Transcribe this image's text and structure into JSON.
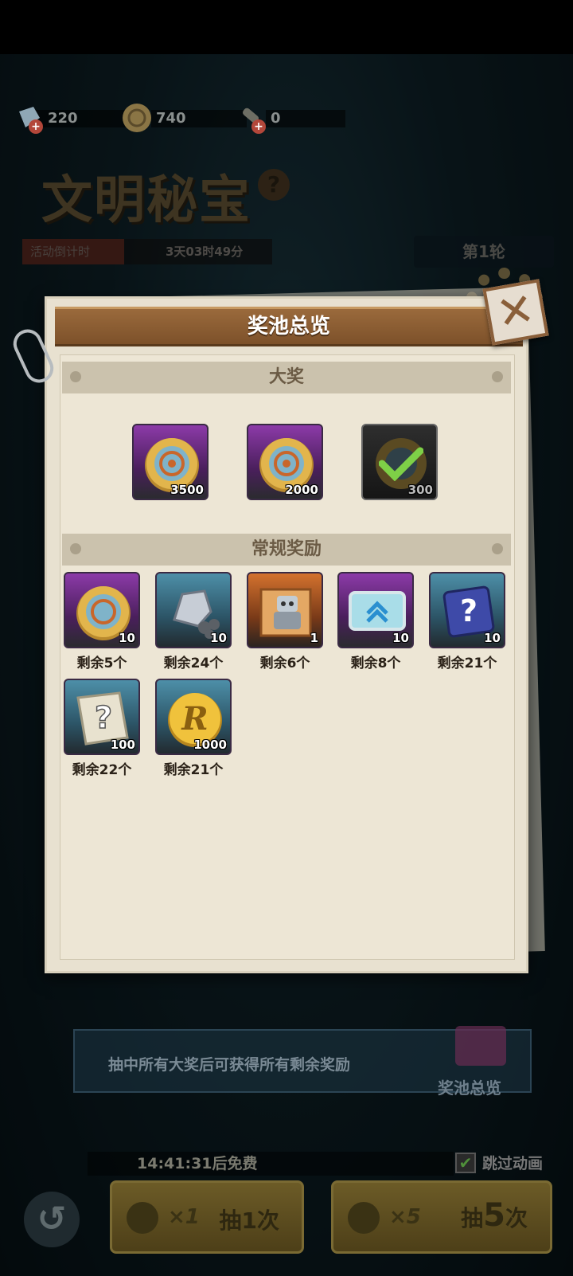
{
  "currencies": [
    {
      "icon": "gem-pack-icon",
      "value": "220"
    },
    {
      "icon": "compass-coin-icon",
      "value": "740"
    },
    {
      "icon": "torch-icon",
      "value": "0"
    }
  ],
  "event": {
    "title": "文明秘宝",
    "help": "?",
    "countdown_label": "活动倒计时",
    "countdown_time": "3天03时49分",
    "round": "第1轮"
  },
  "modal": {
    "title": "奖池总览",
    "close": "✕",
    "grand_section": "大奖",
    "grand_prizes": [
      {
        "icon": "compass-coin-icon",
        "qty": "3500",
        "rarity": "purple",
        "claimed": false
      },
      {
        "icon": "compass-coin-icon",
        "qty": "2000",
        "rarity": "purple",
        "claimed": false
      },
      {
        "icon": "compass-coin-icon",
        "qty": "300",
        "rarity": "dark",
        "claimed": true
      }
    ],
    "regular_section": "常规奖励",
    "regular_rewards": [
      {
        "icon": "compass-coin-icon",
        "qty": "10",
        "rarity": "purple",
        "remaining": "剩余5个"
      },
      {
        "icon": "ore-icon",
        "qty": "10",
        "rarity": "blue",
        "remaining": "剩余24个"
      },
      {
        "icon": "robot-puzzle-icon",
        "qty": "1",
        "rarity": "orange",
        "remaining": "剩余6个"
      },
      {
        "icon": "rank-up-card-icon",
        "qty": "10",
        "rarity": "purple",
        "remaining": "剩余8个"
      },
      {
        "icon": "mystery-box-icon",
        "qty": "10",
        "rarity": "blue",
        "remaining": "剩余21个"
      },
      {
        "icon": "mystery-map-icon",
        "qty": "100",
        "rarity": "blue",
        "remaining": "剩余22个"
      },
      {
        "icon": "gold-r-coin-icon",
        "qty": "1000",
        "rarity": "blue",
        "remaining": "剩余21个"
      }
    ]
  },
  "bottom": {
    "hint": "抽中所有大奖后可获得所有剩余奖励",
    "pool_button": "奖池总览",
    "free_timer": "14:41:31后免费",
    "skip_label": "跳过动画",
    "skip_checked": "✔",
    "back": "↺",
    "draw1_mult": "×1",
    "draw1_prefix": "抽",
    "draw1_count": "1",
    "draw1_suffix": "次",
    "draw5_mult": "×5",
    "draw5_prefix": "抽",
    "draw5_count": "5",
    "draw5_suffix": "次"
  }
}
